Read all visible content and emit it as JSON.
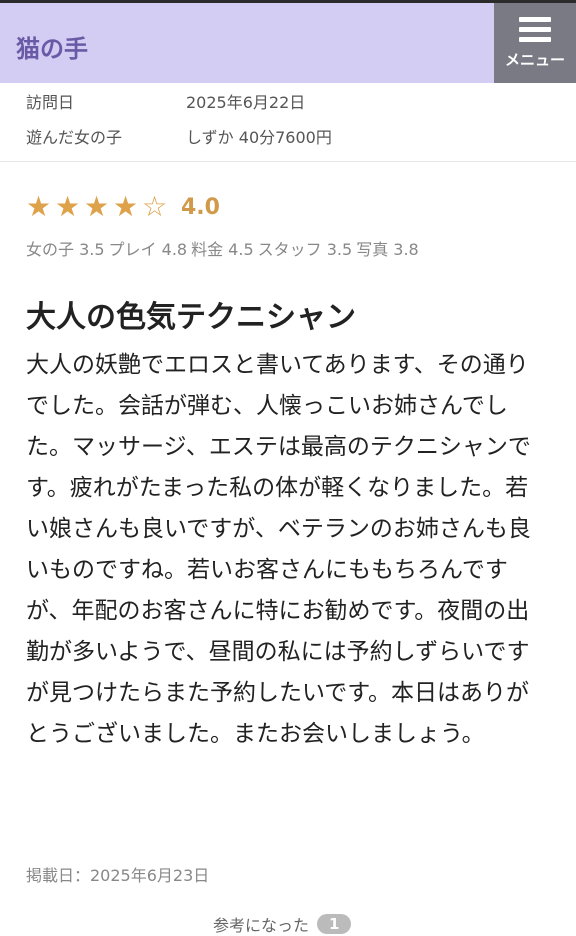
{
  "header": {
    "brand": "猫の手",
    "menu_label": "メニュー"
  },
  "info": {
    "visit_label": "訪問日",
    "visit_value": "2025年6月22日",
    "girl_label": "遊んだ女の子",
    "girl_value": "しずか 40分7600円"
  },
  "rating": {
    "stars_full": 4,
    "stars_total": 5,
    "score": "4.0",
    "subscores": [
      "女の子 3.5",
      "プレイ 4.8",
      "料金 4.5",
      "スタッフ 3.5",
      "写真 3.8"
    ],
    "star_color": "#dea24a"
  },
  "review": {
    "title": "大人の色気テクニシャン",
    "body": "大人の妖艶でエロスと書いてあります、その通りでした。会話が弾む、人懐っこいお姉さんでした。マッサージ、エステは最高のテクニシャンです。疲れがたまった私の体が軽くなりました。若い娘さんも良いですが、ベテランのお姉さんも良いものですね。若いお客さんにももちろんですが、年配のお客さんに特にお勧めです。夜間の出勤が多いようで、昼間の私には予約しずらいですが見つけたらまた予約したいです。本日はありがとうございました。またお会いしましょう。",
    "posted": "掲載日：2025年6月23日"
  },
  "helpful": {
    "label": "参考になった",
    "count": "1"
  }
}
